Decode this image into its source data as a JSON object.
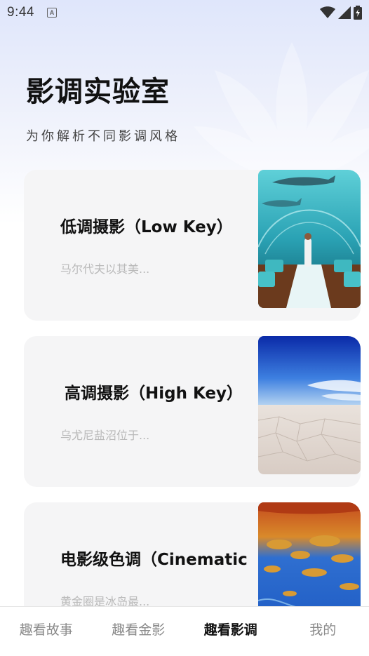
{
  "status_bar": {
    "time": "9:44",
    "notification_icon_letter": "A",
    "icons": [
      "wifi-icon",
      "signal-icon",
      "battery-charging-icon"
    ]
  },
  "header": {
    "title": "影调实验室",
    "subtitle": "为你解析不同影调风格"
  },
  "cards": [
    {
      "title": "低调摄影（Low Key）",
      "description": "马尔代夫以其美...",
      "image": "underwater-restaurant-photo"
    },
    {
      "title": "高调摄影（High Key）",
      "description": "乌尤尼盐沼位于...",
      "image": "salt-flat-photo"
    },
    {
      "title": "电影级色调（Cinematic",
      "description": "黄金圈是冰岛最...",
      "image": "iceland-landscape-photo"
    }
  ],
  "bottom_nav": {
    "items": [
      {
        "label": "趣看故事",
        "active": false
      },
      {
        "label": "趣看金影",
        "active": false
      },
      {
        "label": "趣看影调",
        "active": true
      },
      {
        "label": "我的",
        "active": false
      }
    ]
  },
  "colors": {
    "header_gradient_top": "#dfe6fb",
    "card_background": "#f5f5f6",
    "active_nav": "#111111",
    "inactive_nav": "#8a8a8a",
    "description_text": "#b9b9b9"
  }
}
